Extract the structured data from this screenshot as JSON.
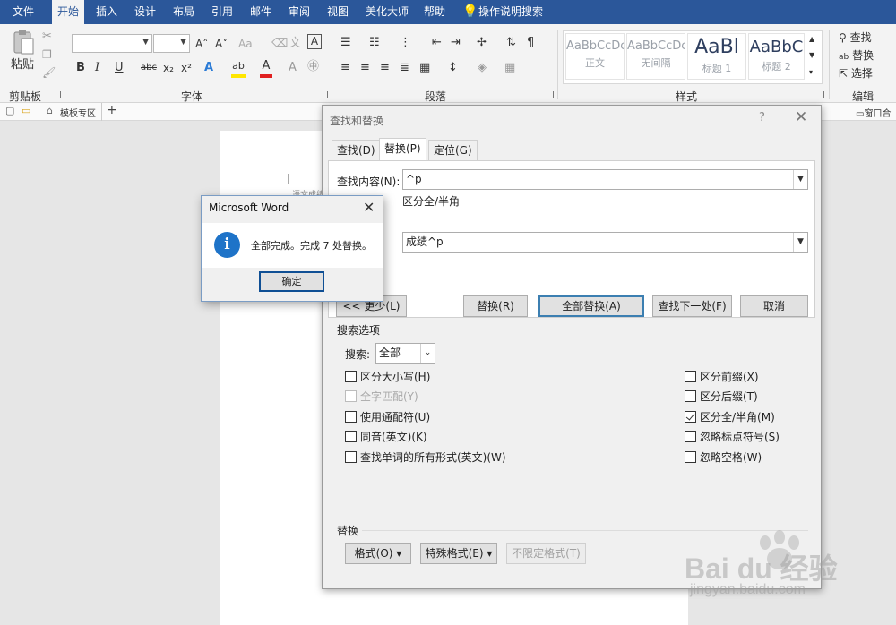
{
  "ribbon_tabs": [
    "文件",
    "开始",
    "插入",
    "设计",
    "布局",
    "引用",
    "邮件",
    "审阅",
    "视图",
    "美化大师",
    "帮助"
  ],
  "tell_me": "操作说明搜索",
  "clipboard": {
    "paste": "粘贴",
    "group": "剪贴板"
  },
  "font_group": {
    "label": "字体",
    "btn_grow": "A˄",
    "btn_shrink": "A˅",
    "btn_case": "Aa",
    "btn_bold": "B",
    "btn_italic": "I",
    "btn_underline": "U",
    "btn_strike": "abc",
    "btn_sub": "x₂",
    "btn_sup": "x²"
  },
  "paragraph_group": {
    "label": "段落"
  },
  "styles_group": {
    "label": "样式",
    "items": [
      {
        "sample": "AaBbCcDc",
        "name": "正文"
      },
      {
        "sample": "AaBbCcDc",
        "name": "无间隔"
      },
      {
        "sample": "AaBl",
        "name": "标题 1"
      },
      {
        "sample": "AaBbC",
        "name": "标题 2"
      }
    ]
  },
  "editing_group": {
    "label": "编辑",
    "find": "查找",
    "replace": "替换",
    "select": "选择"
  },
  "docbar": {
    "template_tab": "模板专区",
    "add": "+",
    "window_btn": "窗口合"
  },
  "document": {
    "snippet": "语文成绩"
  },
  "find_replace": {
    "title": "查找和替换",
    "help": "?",
    "close": "✕",
    "tabs": [
      "查找(D)",
      "替换(P)",
      "定位(G)"
    ],
    "active_tab": "替换(P)",
    "find_label": "查找内容(N):",
    "find_value": "^p",
    "find_options": "区分全/半角",
    "replace_value": "成绩^p",
    "btn_less": "<< 更少(L)",
    "btn_replace": "替换(R)",
    "btn_replace_all": "全部替换(A)",
    "btn_find_next": "查找下一处(F)",
    "btn_cancel": "取消",
    "search_options_label": "搜索选项",
    "search_label": "搜索:",
    "search_value": "全部",
    "left_checks": [
      {
        "label": "区分大小写(H)",
        "checked": false,
        "disabled": false
      },
      {
        "label": "全字匹配(Y)",
        "checked": false,
        "disabled": true
      },
      {
        "label": "使用通配符(U)",
        "checked": false,
        "disabled": false
      },
      {
        "label": "同音(英文)(K)",
        "checked": false,
        "disabled": false
      },
      {
        "label": "查找单词的所有形式(英文)(W)",
        "checked": false,
        "disabled": false
      }
    ],
    "right_checks": [
      {
        "label": "区分前缀(X)",
        "checked": false
      },
      {
        "label": "区分后缀(T)",
        "checked": false
      },
      {
        "label": "区分全/半角(M)",
        "checked": true
      },
      {
        "label": "忽略标点符号(S)",
        "checked": false
      },
      {
        "label": "忽略空格(W)",
        "checked": false
      }
    ],
    "replace_section": "替换",
    "btn_format": "格式(O) ▾",
    "btn_special": "特殊格式(E) ▾",
    "btn_no_format": "不限定格式(T)"
  },
  "message_box": {
    "title": "Microsoft Word",
    "close": "✕",
    "icon": "i",
    "text": "全部完成。完成 7 处替换。",
    "ok": "确定"
  },
  "watermark": {
    "brand": "Bai du 经验",
    "url": "jingyan.baidu.com"
  }
}
